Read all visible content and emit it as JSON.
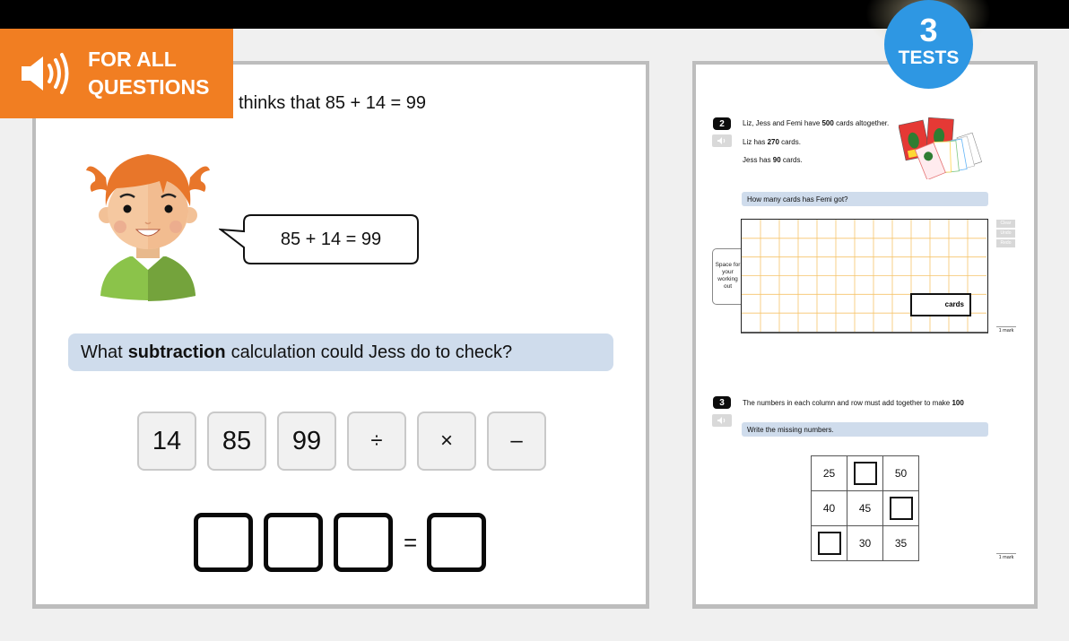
{
  "banner": {
    "icon": "speaker-icon",
    "line1": "FOR ALL",
    "line2": "QUESTIONS",
    "color": "#f17e22"
  },
  "badge": {
    "number": "3",
    "label": "TESTS",
    "color": "#2e97e3"
  },
  "left": {
    "intro_text": "thinks that 85 + 14 = 99",
    "speech_bubble": "85 + 14 = 99",
    "prompt": {
      "before": "What",
      "bold": "subtraction",
      "after": "calculation could Jess do to check?"
    },
    "tiles": [
      "14",
      "85",
      "99",
      "÷",
      "×",
      "–"
    ],
    "answer": {
      "slots_before_equals": 3,
      "equals": "=",
      "slots_after_equals": 1
    }
  },
  "right": {
    "q2": {
      "number": "2",
      "line1": {
        "before": "Liz, Jess and Femi have ",
        "bold": "500",
        "after": " cards altogether."
      },
      "line2": {
        "before": "Liz has ",
        "bold": "270",
        "after": " cards."
      },
      "line3": {
        "before": "Jess has ",
        "bold": "90",
        "after": " cards."
      },
      "prompt": "How many cards has Femi got?",
      "working_label": "Space for your working out",
      "answer_unit": "cards",
      "controls": [
        "Clear",
        "Undo",
        "Redo"
      ],
      "mark": "1 mark"
    },
    "q3": {
      "number": "3",
      "line1": {
        "before": "The numbers in each column and row must add together to make ",
        "bold": "100"
      },
      "prompt": "Write the missing numbers.",
      "grid": [
        [
          "25",
          "",
          "50"
        ],
        [
          "40",
          "45",
          ""
        ],
        [
          "",
          "30",
          "35"
        ]
      ],
      "mark": "1 mark"
    }
  }
}
